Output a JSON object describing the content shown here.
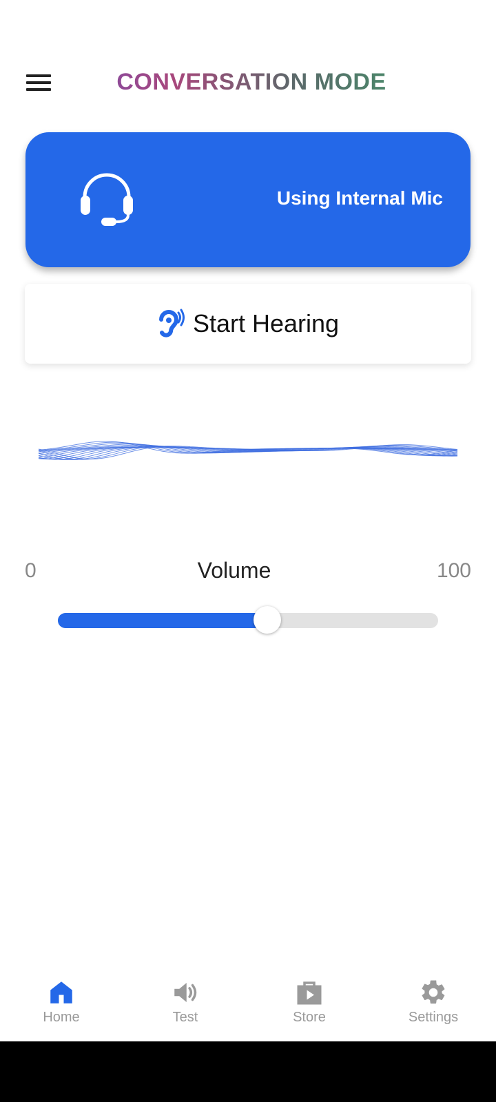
{
  "header": {
    "title": "CONVERSATION MODE",
    "menu_icon": "hamburger-menu-icon"
  },
  "mic_card": {
    "icon": "headset-icon",
    "label": "Using Internal Mic",
    "color": "#2468e8"
  },
  "start_button": {
    "icon": "hearing-ear-icon",
    "label": "Start Hearing"
  },
  "volume": {
    "label": "Volume",
    "min": "0",
    "max": "100",
    "value": 55
  },
  "nav": {
    "items": [
      {
        "label": "Home",
        "icon": "home-icon",
        "active": true
      },
      {
        "label": "Test",
        "icon": "speaker-icon",
        "active": false
      },
      {
        "label": "Store",
        "icon": "store-bag-icon",
        "active": false
      },
      {
        "label": "Settings",
        "icon": "gear-icon",
        "active": false
      }
    ]
  },
  "colors": {
    "accent": "#2468e8",
    "inactive": "#9a9a9a"
  }
}
